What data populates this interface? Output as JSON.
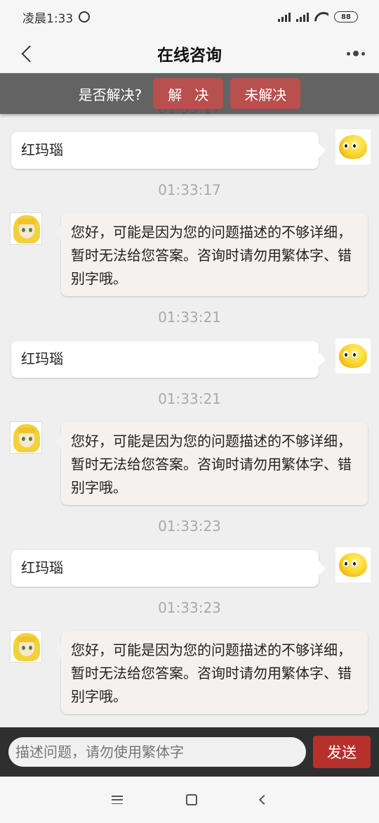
{
  "status_bar": {
    "time": "凌晨1:33",
    "battery": "88"
  },
  "header": {
    "title": "在线咨询"
  },
  "resolve_bar": {
    "question": "是否解决?",
    "resolved_label": "解决",
    "unresolved_label": "未解决"
  },
  "chat": {
    "hidden_time": "01:33:17",
    "messages": [
      {
        "sender": "user",
        "text": "红玛瑙"
      },
      {
        "time": "01:33:17"
      },
      {
        "sender": "bot",
        "text": "您好，可能是因为您的问题描述的不够详细，暂时无法给您答案。咨询时请勿用繁体字、错别字哦。"
      },
      {
        "time": "01:33:21"
      },
      {
        "sender": "user",
        "text": "红玛瑙"
      },
      {
        "time": "01:33:21"
      },
      {
        "sender": "bot",
        "text": "您好，可能是因为您的问题描述的不够详细，暂时无法给您答案。咨询时请勿用繁体字、错别字哦。"
      },
      {
        "time": "01:33:23"
      },
      {
        "sender": "user",
        "text": "红玛瑙"
      },
      {
        "time": "01:33:23"
      },
      {
        "sender": "bot",
        "text": "您好，可能是因为您的问题描述的不够详细，暂时无法给您答案。咨询时请勿用繁体字、错别字哦。"
      }
    ]
  },
  "input": {
    "placeholder": "描述问题，请勿使用繁体字",
    "send_label": "发送"
  }
}
